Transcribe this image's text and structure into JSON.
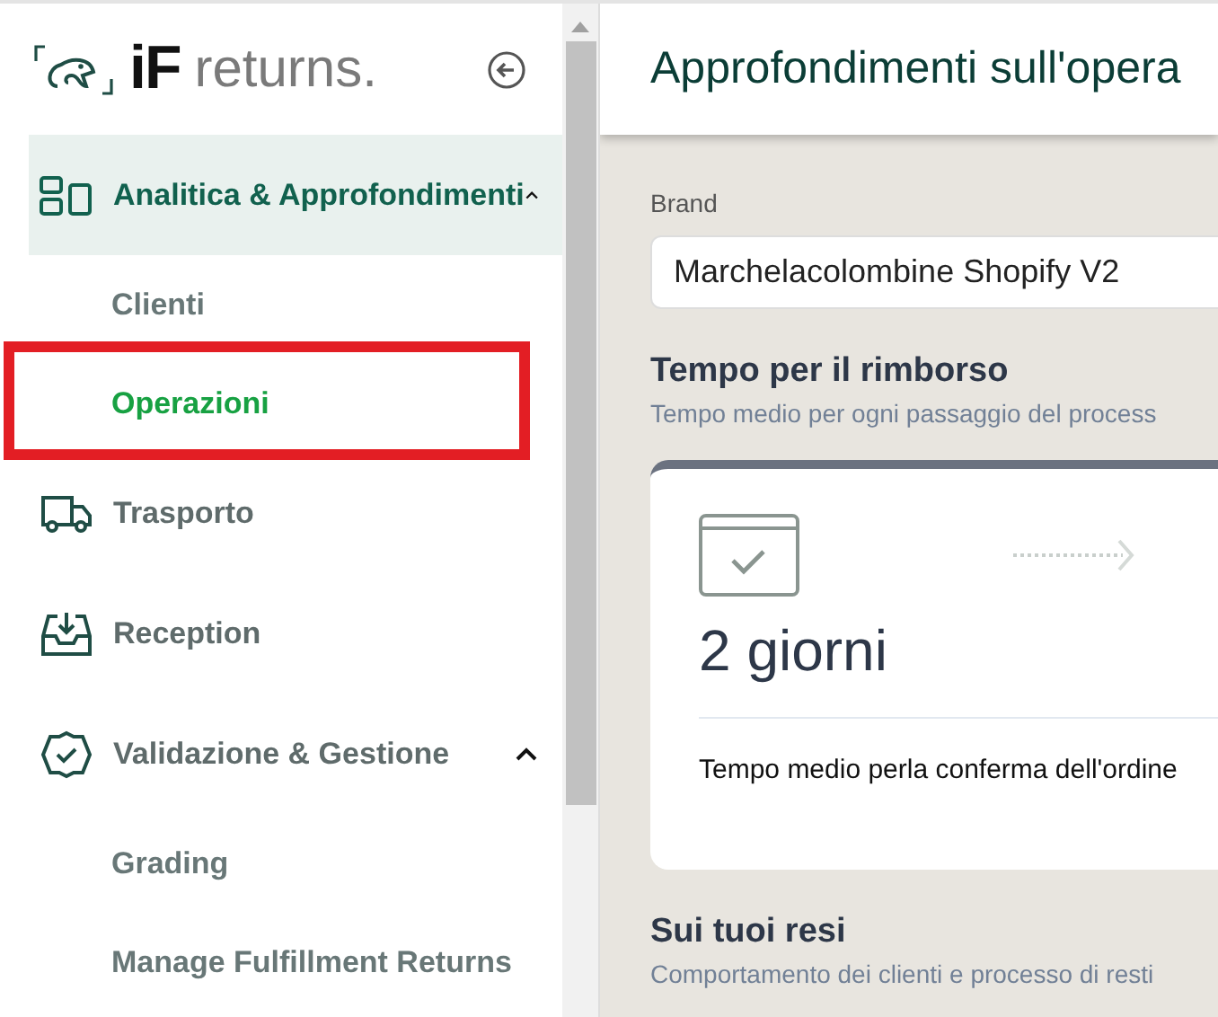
{
  "logo": {
    "mark": "iF",
    "word": "returns."
  },
  "sidebar": {
    "items": [
      {
        "label": "Analitica & Approfondimenti",
        "selected": true,
        "expanded": true,
        "children": [
          {
            "label": "Clienti",
            "selected": false,
            "annotated": false
          },
          {
            "label": "Operazioni",
            "selected": true,
            "annotated": true
          }
        ]
      },
      {
        "label": "Trasporto",
        "selected": false
      },
      {
        "label": "Reception",
        "selected": false
      },
      {
        "label": "Validazione & Gestione",
        "selected": false,
        "expanded": true,
        "children": [
          {
            "label": "Grading",
            "selected": false,
            "annotated": false
          },
          {
            "label": "Manage Fulfillment Returns",
            "selected": false,
            "annotated": false
          }
        ]
      }
    ]
  },
  "header": {
    "title": "Approfondimenti sull'opera"
  },
  "brand_select": {
    "label": "Brand",
    "value": "Marchelacolombine Shopify V2"
  },
  "sections": [
    {
      "title": "Tempo per il rimborso",
      "subtitle": "Tempo medio per ogni passaggio del process",
      "card": {
        "value": "2 giorni",
        "description": "Tempo medio perla conferma dell'ordine"
      }
    },
    {
      "title": "Sui tuoi resi",
      "subtitle": "Comportamento dei clienti e processo di resti"
    }
  ]
}
